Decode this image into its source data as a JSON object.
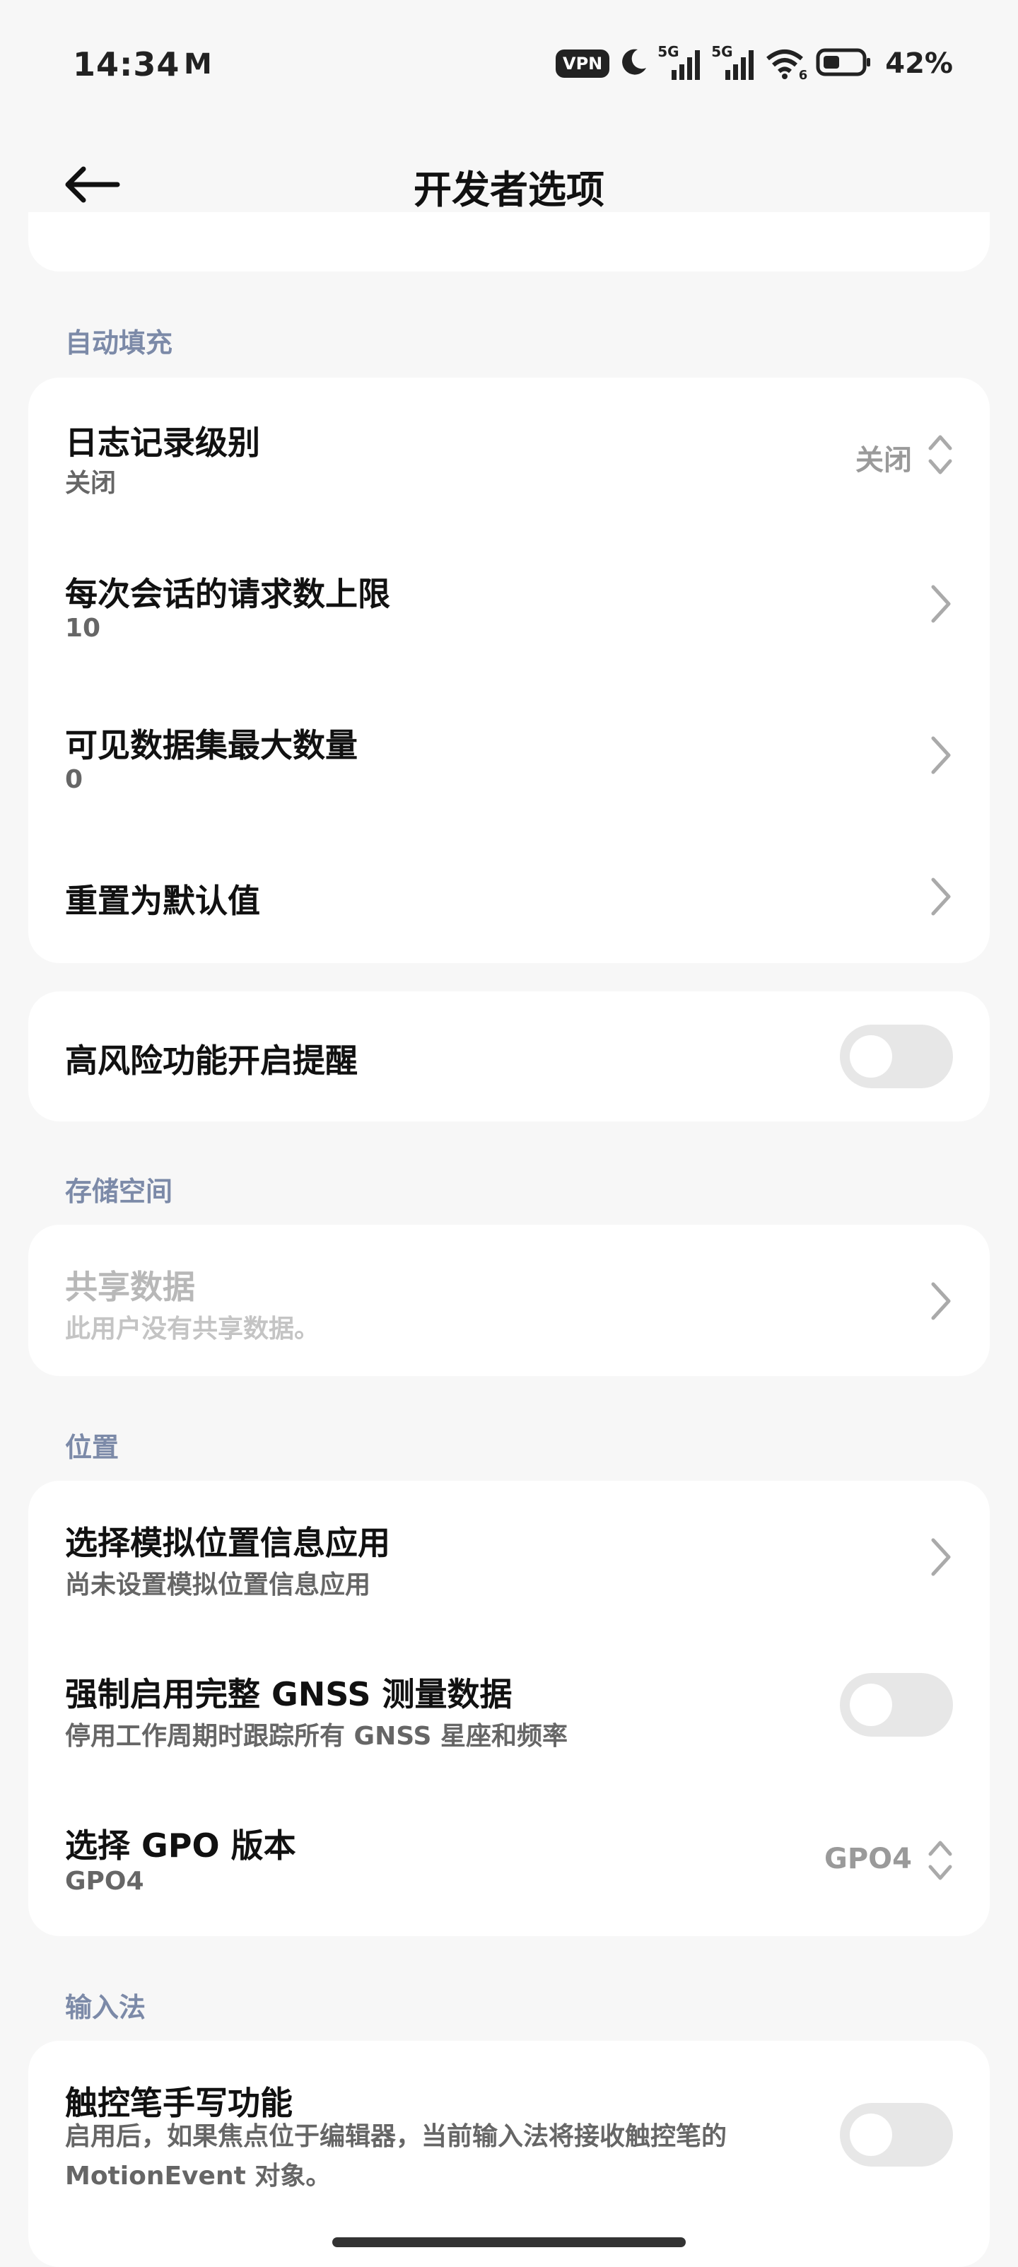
{
  "status_bar": {
    "time": "14:34",
    "carrier_icon_text": "M",
    "vpn": "VPN",
    "network1": "5G",
    "network2": "5G",
    "wifi_sub": "6",
    "battery": "42%"
  },
  "header": {
    "title": "开发者选项"
  },
  "sections": {
    "autofill": {
      "header": "自动填充",
      "log_level": {
        "title": "日志记录级别",
        "sub": "关闭",
        "value": "关闭"
      },
      "max_requests": {
        "title": "每次会话的请求数上限",
        "sub": "10"
      },
      "max_datasets": {
        "title": "可见数据集最大数量",
        "sub": "0"
      },
      "reset": {
        "title": "重置为默认值"
      }
    },
    "risk": {
      "title": "高风险功能开启提醒",
      "toggle_on": false
    },
    "storage": {
      "header": "存储空间",
      "shared": {
        "title": "共享数据",
        "sub": "此用户没有共享数据。"
      }
    },
    "location": {
      "header": "位置",
      "mock_app": {
        "title": "选择模拟位置信息应用",
        "sub": "尚未设置模拟位置信息应用"
      },
      "gnss": {
        "title": "强制启用完整 GNSS 测量数据",
        "sub": "停用工作周期时跟踪所有 GNSS 星座和频率",
        "toggle_on": false
      },
      "gpo": {
        "title": "选择 GPO 版本",
        "sub": "GPO4",
        "value": "GPO4"
      }
    },
    "input": {
      "header": "输入法",
      "stylus": {
        "title": "触控笔手写功能",
        "sub": "启用后，如果焦点位于编辑器，当前输入法将接收触控笔的 MotionEvent 对象。",
        "toggle_on": false
      }
    }
  },
  "colors": {
    "background": "#f7f7f7",
    "card": "#ffffff",
    "section_header": "#7c8aa8",
    "toggle_off": "#e7e7e7"
  }
}
